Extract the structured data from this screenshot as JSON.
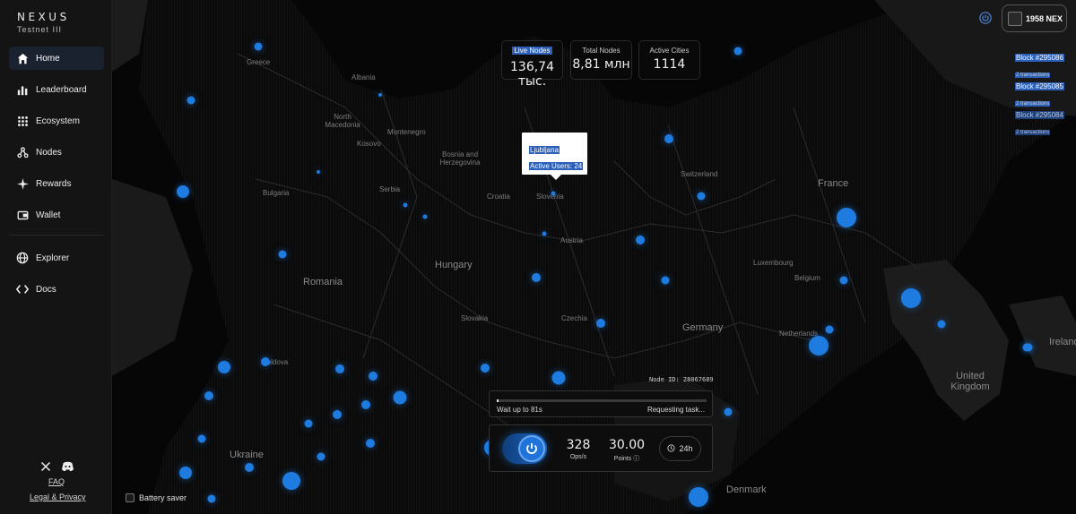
{
  "app": {
    "brand": "NEXUS",
    "network": "Testnet III"
  },
  "sidebar": {
    "items": [
      {
        "label": "Home",
        "icon": "home-icon",
        "active": true
      },
      {
        "label": "Leaderboard",
        "icon": "bar-chart-icon"
      },
      {
        "label": "Ecosystem",
        "icon": "grid-icon"
      },
      {
        "label": "Nodes",
        "icon": "nodes-icon"
      },
      {
        "label": "Rewards",
        "icon": "sparkle-icon"
      },
      {
        "label": "Wallet",
        "icon": "wallet-icon"
      }
    ],
    "secondary": [
      {
        "label": "Explorer",
        "icon": "globe-icon"
      },
      {
        "label": "Docs",
        "icon": "code-icon"
      }
    ],
    "faq": "FAQ",
    "legal": "Legal & Privacy"
  },
  "stats": {
    "live_nodes": {
      "label": "Live Nodes",
      "value": "136,74 тыс."
    },
    "total_nodes": {
      "label": "Total Nodes",
      "value": "8,81 млн"
    },
    "active_cities": {
      "label": "Active Cities",
      "value": "1114"
    }
  },
  "tooltip": {
    "city": "Ljubljana",
    "users": "Active Users: 24"
  },
  "account": {
    "balance": "1958 NEX"
  },
  "blocks": [
    {
      "number": "Block #295086",
      "tx": "2 transactions"
    },
    {
      "number": "Block #295085",
      "tx": "2 transactions"
    },
    {
      "number": "Block #295084",
      "tx": "2 transactions"
    }
  ],
  "node": {
    "id_text": "Node ID: 28067689",
    "wait_text": "Wait up to 81s",
    "status_text": "Requesting task...",
    "progress": 0.01,
    "ops_value": "328",
    "ops_label": "Ops/s",
    "points_value": "30.00",
    "points_label": "Points",
    "range": "24h"
  },
  "battery": {
    "label": "Battery saver",
    "checked": false
  },
  "map_labels": [
    "Greece",
    "Albania",
    "North Macedonia",
    "Kosovo",
    "Montenegro",
    "Bosnia and Herzegovina",
    "Serbia",
    "Croatia",
    "Slovenia",
    "Bulgaria",
    "Austria",
    "Hungary",
    "Romania",
    "Slovakia",
    "Czechia",
    "Switzerland",
    "France",
    "Luxembourg",
    "Belgium",
    "Germany",
    "Netherlands",
    "Moldova",
    "Ukraine",
    "United Kingdom",
    "Ireland",
    "Denmark"
  ],
  "colors": {
    "accent": "#1e7be0",
    "selection": "#2b5fb8"
  }
}
